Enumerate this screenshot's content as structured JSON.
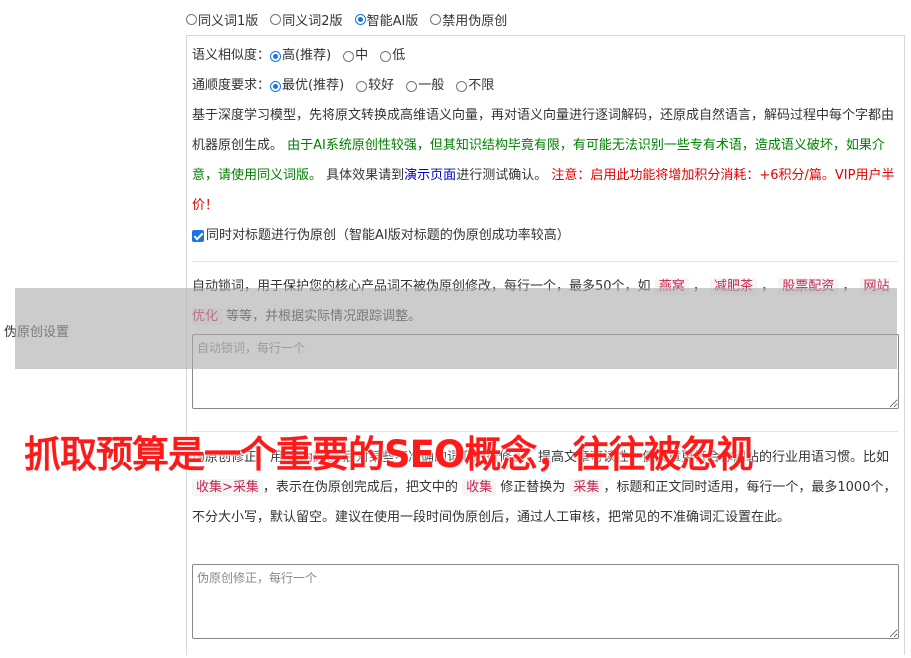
{
  "version": {
    "options": [
      {
        "label": "同义词1版",
        "checked": false
      },
      {
        "label": "同义词2版",
        "checked": false
      },
      {
        "label": "智能AI版",
        "checked": true
      },
      {
        "label": "禁用伪原创",
        "checked": false
      }
    ]
  },
  "similarity": {
    "label": "语义相似度：",
    "options": [
      {
        "label": "高(推荐)",
        "checked": true
      },
      {
        "label": "中",
        "checked": false
      },
      {
        "label": "低",
        "checked": false
      }
    ]
  },
  "fluency": {
    "label": "通顺度要求：",
    "options": [
      {
        "label": "最优(推荐)",
        "checked": true
      },
      {
        "label": "较好",
        "checked": false
      },
      {
        "label": "一般",
        "checked": false
      },
      {
        "label": "不限",
        "checked": false
      }
    ]
  },
  "description": {
    "intro": "基于深度学习模型，先将原文转换成高维语义向量，再对语义向量进行逐词解码，还原成自然语言，解码过程中每个字都由机器原创生成。",
    "warning_green": "由于AI系统原创性较强，但其知识结构毕竟有限，有可能无法识别一些专有术语，造成语义破坏，如果介意，请使用同义词版。",
    "effect_prefix": "具体效果请到",
    "demo_link": "演示页面",
    "effect_suffix": "进行测试确认。",
    "notice_red": "注意：启用此功能将增加积分消耗：+6积分/篇。VIP用户半价！"
  },
  "title_option": {
    "label": "同时对标题进行伪原创（智能AI版对标题的伪原创成功率较高）",
    "checked": true
  },
  "lock_words": {
    "desc_prefix": "自动锁词，用于保护您的核心产品词不被伪原创修改，每行一个，最多50个，如",
    "examples": [
      "燕窝",
      "减肥茶",
      "股票配资",
      "网站优化"
    ],
    "desc_suffix": "等等，并根据实际情况跟踪调整。",
    "placeholder": "自动锁词，每行一个"
  },
  "section_label": "伪原创设置",
  "corrections": {
    "desc_prefix": "伪原创修正，用于",
    "desc_tag": "伪原创",
    "desc_mid1": "后对某些不准确的词汇进行修正，提高文章可读性，使文章更符合你网站的行业用语习惯。比如",
    "tag_example": "收集>采集",
    "desc_mid2": "，表示在伪原创完成后，把文中的",
    "tag_from": "收集",
    "desc_mid3": "修正替换为",
    "tag_to": "采集",
    "desc_suffix": "，标题和正文同时适用，每行一个，最多1000个，不分大小写，默认留空。建议在使用一段时间伪原创后，通过人工审核，把常见的不准确词汇设置在此。",
    "placeholder": "伪原创修正，每行一个"
  },
  "banner": "抓取预算是一个重要的SEO概念，往往被忽视",
  "colors": {
    "accent": "#1a73e8",
    "warning_green": "#008000",
    "notice_red": "#e60000",
    "banner": "#ff1a1a"
  }
}
